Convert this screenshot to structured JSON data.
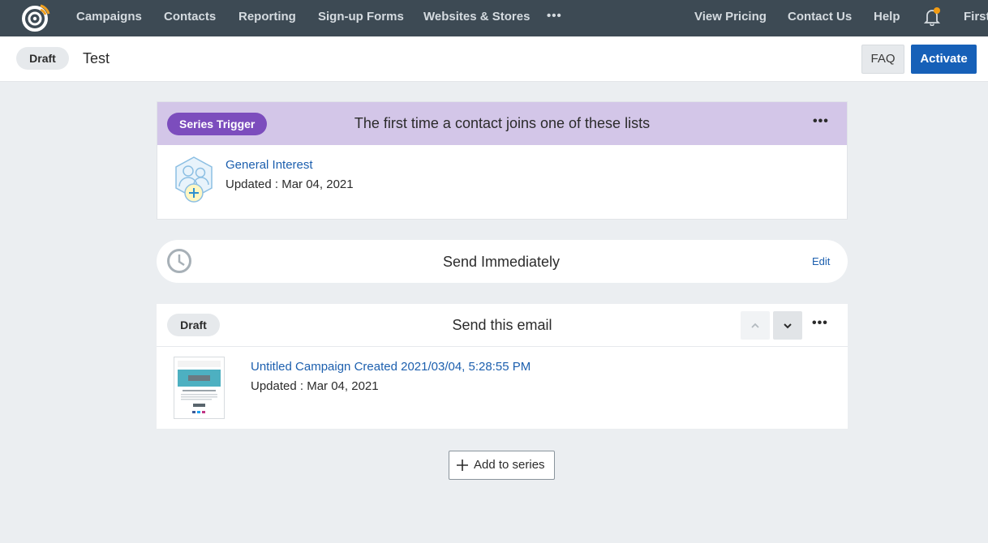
{
  "nav": {
    "items": [
      "Campaigns",
      "Contacts",
      "Reporting",
      "Sign-up Forms",
      "Websites & Stores"
    ],
    "more": "•••",
    "right_items": [
      "View Pricing",
      "Contact Us",
      "Help"
    ],
    "user": "First",
    "logo_icon": "constant-contact-logo-icon",
    "notification_icon": "bell-icon",
    "notification_dot_color": "#f39c12"
  },
  "header": {
    "status": "Draft",
    "title": "Test",
    "faq_label": "FAQ",
    "activate_label": "Activate"
  },
  "trigger": {
    "badge": "Series Trigger",
    "title": "The first time a contact joins one of these lists",
    "menu": "•••",
    "list_name": "General Interest",
    "updated": "Updated : Mar 04, 2021",
    "icon": "contact-list-add-icon"
  },
  "wait": {
    "title": "Send Immediately",
    "edit_label": "Edit",
    "icon": "clock-icon"
  },
  "email": {
    "status": "Draft",
    "title": "Send this email",
    "menu": "•••",
    "campaign_name": "Untitled Campaign Created 2021/03/04, 5:28:55 PM",
    "updated": "Updated : Mar 04, 2021",
    "thumb_icon": "email-thumbnail-icon"
  },
  "actions": {
    "add_label": "Add to series"
  },
  "colors": {
    "nav_bg": "#3d4a54",
    "accent_blue": "#1660b8",
    "trigger_header": "#d3c6e8",
    "trigger_badge": "#7c4dbd",
    "page_bg": "#ebeef1"
  }
}
